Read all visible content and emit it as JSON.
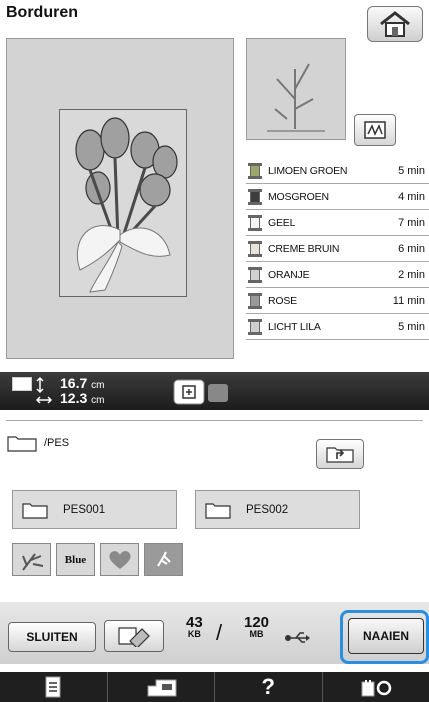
{
  "header": {
    "title": "Borduren"
  },
  "threads": [
    {
      "name": "LIMOEN GROEN",
      "time": "5 min",
      "color": "#9aa86a"
    },
    {
      "name": "MOSGROEN",
      "time": "4 min",
      "color": "#3d3d3d"
    },
    {
      "name": "GEEL",
      "time": "7 min",
      "color": "#f4f4f4"
    },
    {
      "name": "CREME BRUIN",
      "time": "6 min",
      "color": "#e8e4dc"
    },
    {
      "name": "ORANJE",
      "time": "2 min",
      "color": "#d0d0d0"
    },
    {
      "name": "ROSE",
      "time": "11 min",
      "color": "#9a9a9a"
    },
    {
      "name": "LICHT LILA",
      "time": "5 min",
      "color": "#cfcfcf"
    }
  ],
  "size": {
    "height": "16.7",
    "width": "12.3",
    "unit": "cm"
  },
  "browser": {
    "path": "/PES",
    "folders": [
      "PES001",
      "PES002"
    ],
    "patterns": [
      "blue-flower-pattern",
      "Blue",
      "heart-pattern",
      "bird-pattern"
    ]
  },
  "bottom": {
    "close_label": "SLUITEN",
    "used": "43",
    "used_unit": "KB",
    "total": "120",
    "total_unit": "MB",
    "sew_label": "NAAIEN"
  },
  "nav": {
    "help_label": "?"
  }
}
